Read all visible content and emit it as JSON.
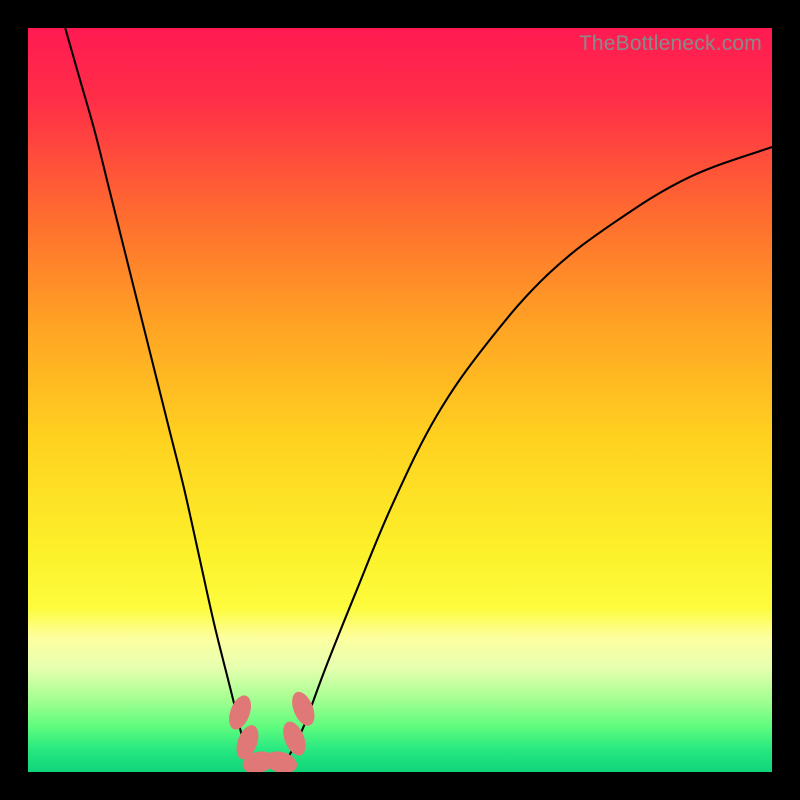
{
  "watermark": "TheBottleneck.com",
  "chart_data": {
    "type": "line",
    "title": "",
    "xlabel": "",
    "ylabel": "",
    "xlim": [
      0,
      100
    ],
    "ylim": [
      0,
      100
    ],
    "gradient_stops": [
      {
        "offset": 0.0,
        "color": "#ff1a52"
      },
      {
        "offset": 0.1,
        "color": "#ff2f47"
      },
      {
        "offset": 0.25,
        "color": "#ff6b2f"
      },
      {
        "offset": 0.4,
        "color": "#ffa324"
      },
      {
        "offset": 0.55,
        "color": "#ffd120"
      },
      {
        "offset": 0.7,
        "color": "#fcf029"
      },
      {
        "offset": 0.78,
        "color": "#fdfc3e"
      },
      {
        "offset": 0.82,
        "color": "#fdffa0"
      },
      {
        "offset": 0.86,
        "color": "#e6ffb0"
      },
      {
        "offset": 0.9,
        "color": "#a8ff92"
      },
      {
        "offset": 0.94,
        "color": "#5dfc7e"
      },
      {
        "offset": 0.97,
        "color": "#27e880"
      },
      {
        "offset": 1.0,
        "color": "#0fd47a"
      }
    ],
    "series": [
      {
        "name": "left-branch",
        "x": [
          5,
          7,
          9,
          11,
          13,
          15,
          17,
          19,
          21,
          23,
          25,
          27,
          28,
          29,
          30
        ],
        "y": [
          100,
          93,
          86,
          78,
          70,
          62,
          54,
          46,
          38,
          29,
          20,
          12,
          8,
          4,
          2
        ]
      },
      {
        "name": "right-branch",
        "x": [
          35,
          37,
          40,
          44,
          49,
          55,
          62,
          70,
          79,
          89,
          100
        ],
        "y": [
          2,
          6,
          14,
          24,
          36,
          48,
          58,
          67,
          74,
          80,
          84
        ]
      },
      {
        "name": "valley-floor",
        "x": [
          30,
          31,
          32.5,
          34,
          35
        ],
        "y": [
          2,
          1,
          1,
          1,
          2
        ]
      }
    ],
    "markers": [
      {
        "x": 28.5,
        "y": 8,
        "rx": 1.3,
        "ry": 2.4,
        "angle": 20
      },
      {
        "x": 29.5,
        "y": 4,
        "rx": 1.3,
        "ry": 2.4,
        "angle": 20
      },
      {
        "x": 31.0,
        "y": 1.3,
        "rx": 1.4,
        "ry": 2.2,
        "angle": 75
      },
      {
        "x": 34.0,
        "y": 1.3,
        "rx": 1.4,
        "ry": 2.2,
        "angle": 105
      },
      {
        "x": 35.8,
        "y": 4.5,
        "rx": 1.3,
        "ry": 2.4,
        "angle": -22
      },
      {
        "x": 37.0,
        "y": 8.5,
        "rx": 1.3,
        "ry": 2.4,
        "angle": -22
      }
    ]
  }
}
